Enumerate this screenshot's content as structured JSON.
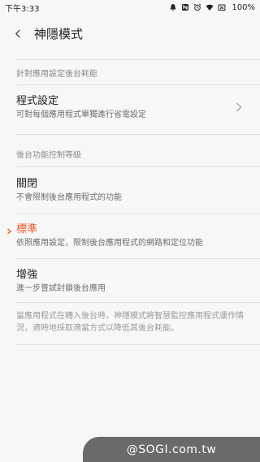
{
  "status_bar": {
    "time": "下午3:33",
    "battery": "100%",
    "icons": [
      "bell-icon",
      "nfc-icon",
      "alarm-icon",
      "wifi-icon",
      "sim-icon"
    ]
  },
  "header": {
    "back_icon": "chevron-left-icon",
    "title": "神隱模式"
  },
  "sections": {
    "app_settings_header": "針對應用設定後台耗能",
    "app_settings": {
      "title": "程式設定",
      "desc": "可對每個應用程式單獨進行省電設定",
      "icon": "chevron-right-icon"
    },
    "background_control_header": "後台功能控制等級",
    "options": [
      {
        "title": "關閉",
        "desc": "不會限制後台應用程式的功能",
        "selected": false
      },
      {
        "title": "標準",
        "desc": "依照應用設定，限制後台應用程式的網路和定位功能",
        "selected": true
      },
      {
        "title": "增強",
        "desc": "進一步嘗試封鎖後台應用",
        "selected": false
      }
    ],
    "footer_note": "當應用程式在轉入後台時，神隱模式將智慧監控應用程式運作情況，適時地採取適當方式以降低其後台耗能。"
  },
  "watermark": "@SOGI.com.tw",
  "colors": {
    "accent": "#f05a28",
    "background": "#f7f7f7",
    "divider": "#e1e1e1",
    "watermark_bg": "#6a6a6a"
  }
}
